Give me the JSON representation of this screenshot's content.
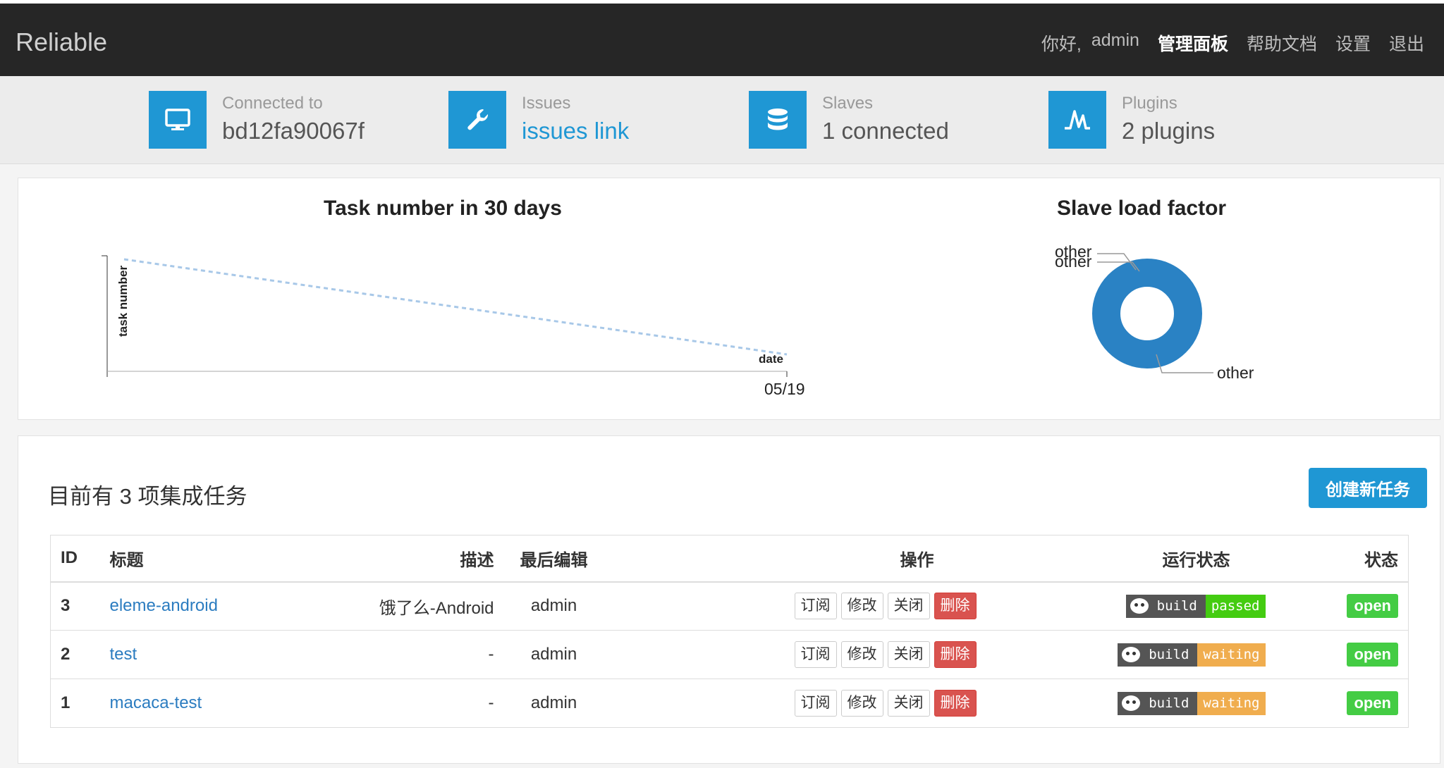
{
  "navbar": {
    "brand": "Reliable",
    "greeting": "你好,",
    "user": "admin",
    "links": [
      "管理面板",
      "帮助文档",
      "设置",
      "退出"
    ]
  },
  "stats": [
    {
      "icon": "monitor-icon",
      "label": "Connected to",
      "value": "bd12fa90067f"
    },
    {
      "icon": "wrench-icon",
      "label": "Issues",
      "value": "issues link"
    },
    {
      "icon": "database-icon",
      "label": "Slaves",
      "value": "1 connected"
    },
    {
      "icon": "plugin-icon",
      "label": "Plugins",
      "value": "2 plugins"
    }
  ],
  "line_chart": {
    "title": "Task number in 30 days",
    "ylabel": "task number",
    "xlabel": "date",
    "tick": "05/19"
  },
  "pie_chart": {
    "title": "Slave load factor",
    "labels": [
      "other",
      "other",
      "other"
    ]
  },
  "chart_data": [
    {
      "type": "line",
      "title": "Task number in 30 days",
      "xlabel": "date",
      "ylabel": "task number",
      "x": [
        "05/19"
      ],
      "series": [
        {
          "values": [
            null
          ]
        }
      ],
      "style": "dashed"
    },
    {
      "type": "pie",
      "title": "Slave load factor",
      "labels": [
        "other",
        "other",
        "other"
      ],
      "values": [
        0,
        0,
        1
      ],
      "donut": true,
      "color": "#2a82c4"
    }
  ],
  "tasks": {
    "heading": "目前有 3 项集成任务",
    "create_label": "创建新任务",
    "columns": [
      "ID",
      "标题",
      "描述",
      "最后编辑",
      "操作",
      "运行状态",
      "状态"
    ],
    "op_labels": [
      "订阅",
      "修改",
      "关闭",
      "删除"
    ],
    "rows": [
      {
        "id": "3",
        "title": "eleme-android",
        "desc": "饿了么-Android",
        "editor": "admin",
        "build": "build",
        "status": "passed",
        "status_color": "#44cc11",
        "state": "open"
      },
      {
        "id": "2",
        "title": "test",
        "desc": "-",
        "editor": "admin",
        "build": "build",
        "status": "waiting",
        "status_color": "#f0ad4e",
        "state": "open"
      },
      {
        "id": "1",
        "title": "macaca-test",
        "desc": "-",
        "editor": "admin",
        "build": "build",
        "status": "waiting",
        "status_color": "#f0ad4e",
        "state": "open"
      }
    ]
  }
}
